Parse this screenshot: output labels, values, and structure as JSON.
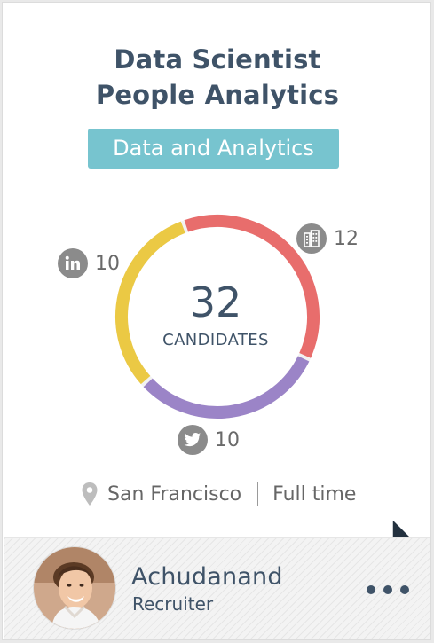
{
  "job": {
    "title_line1": "Data Scientist",
    "title_line2": "People Analytics",
    "department": "Data and Analytics"
  },
  "candidates": {
    "total": "32",
    "label": "CANDIDATES",
    "sources": [
      {
        "name": "linkedin",
        "icon": "linkedin-icon",
        "count": "10",
        "color": "#ebc944"
      },
      {
        "name": "company",
        "icon": "building-icon",
        "count": "12",
        "color": "#e86d6c"
      },
      {
        "name": "twitter",
        "icon": "twitter-icon",
        "count": "10",
        "color": "#9b84c7"
      }
    ]
  },
  "meta": {
    "location": "San Francisco",
    "type": "Full time"
  },
  "recruiter": {
    "name": "Achudanand",
    "role": "Recruiter"
  },
  "colors": {
    "title": "#3f5368",
    "tag": "#77c4cf",
    "yellow": "#ebc944",
    "red": "#e86d6c",
    "purple": "#9b84c7",
    "icon_gray": "#8b8b8b"
  }
}
